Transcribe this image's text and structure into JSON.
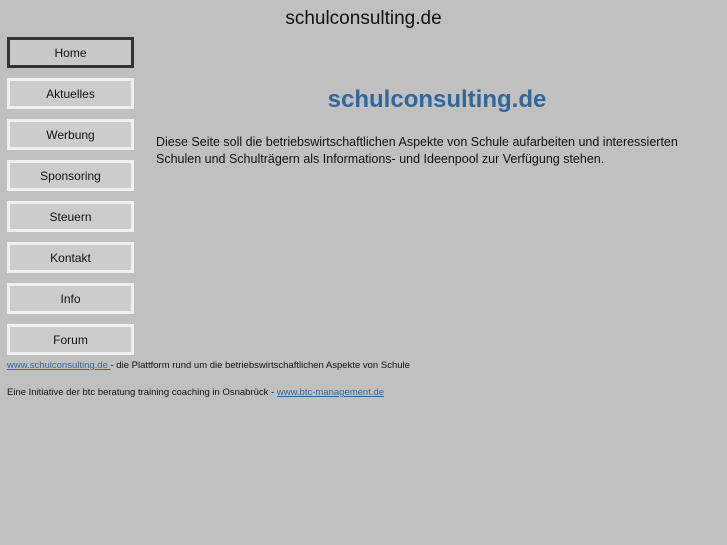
{
  "header": {
    "title": "schulconsulting.de"
  },
  "nav": {
    "items": [
      {
        "label": "Home",
        "active": true
      },
      {
        "label": "Aktuelles"
      },
      {
        "label": "Werbung"
      },
      {
        "label": "Sponsoring"
      },
      {
        "label": "Steuern"
      },
      {
        "label": "Kontakt"
      },
      {
        "label": "Info"
      },
      {
        "label": "Forum"
      }
    ]
  },
  "main": {
    "heading": "schulconsulting.de",
    "intro": "Diese Seite soll die betriebswirtschaftlichen Aspekte von Schule aufarbeiten und interessierten Schulen und Schulträgern als Informations- und Ideenpool zur Verfügung stehen."
  },
  "footer": {
    "line1_link": "www.schulconsulting.de ",
    "line1_text": " - die Plattform rund um die betriebswirtschaftlichen Aspekte von Schule",
    "line2_text": "Eine Initiative der btc beratung training coaching in Osnabrück - ",
    "line2_link": "www.btc-management.de"
  },
  "colors": {
    "background": "#c0c0c0",
    "accent": "#336699"
  }
}
